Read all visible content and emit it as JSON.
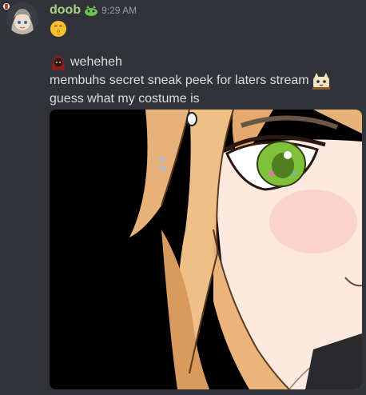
{
  "message": {
    "author": "doob",
    "timestamp": "9:29 AM",
    "lines": [
      "weheheh",
      "membuhs secret sneak peek for laters stream",
      "guess what my costume is"
    ]
  },
  "icons": {
    "avatar": "anime-girl-avatar",
    "role_badge": "green-role-icon",
    "first_emoji": "shushing-face-emoji",
    "line1_emoji": "hooded-figure-emoji",
    "line2_emoji": "peeking-cat-emoji"
  },
  "colors": {
    "background": "#313338",
    "username": "#a7d383",
    "text": "#dbdee1",
    "timestamp": "#949ba4"
  }
}
